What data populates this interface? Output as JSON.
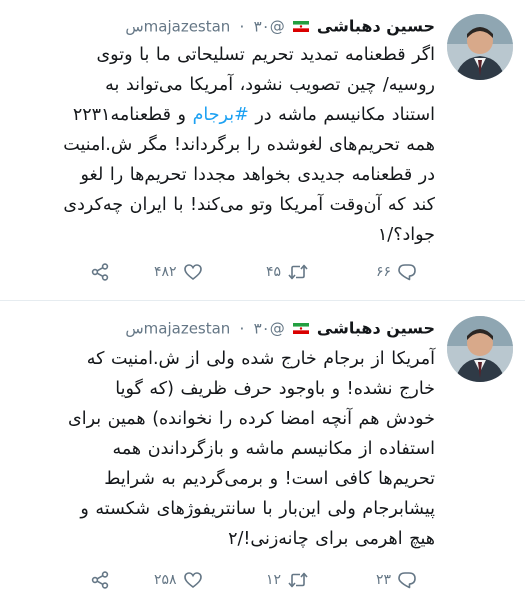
{
  "tweets": [
    {
      "author_name": "حسین دهباشی",
      "handle": "@majazestan",
      "time": "۳۰س",
      "lines": [
        {
          "text": "اگر قطعنامه تمدید تحریم تسلیحاتی ما با وتوی"
        },
        {
          "text": "روسیه/ چین تصویب نشود، آمریکا می‌تواند به"
        },
        {
          "before": "استناد مکانیسم ماشه در ",
          "hashtag": "#برجام",
          "after": " و قطعنامه۲۲۳۱"
        },
        {
          "text": "همه تحریم‌های لغوشده را برگرداند! مگر ش.امنیت"
        },
        {
          "text": "در قطعنامه جدیدی بخواهد مجددا تحریم‌ها را لغو"
        },
        {
          "text": "کند که آن‌وقت آمریکا وتو می‌کند! با ایران چه‌کردی"
        },
        {
          "text": "جواد؟/۱"
        }
      ],
      "replies": "۶۶",
      "retweets": "۴۵",
      "likes": "۴۸۲"
    },
    {
      "author_name": "حسین دهباشی",
      "handle": "@majazestan",
      "time": "۳۰س",
      "lines": [
        {
          "text": "آمریکا از برجام خارج شده ولی از ش.امنیت که"
        },
        {
          "text": "خارج نشده! و باوجود حرف ظریف (که گویا"
        },
        {
          "text": "خودش هم آنچه امضا کرده را نخوانده) همین برای"
        },
        {
          "text": "استفاده از مکانیسم ماشه و بازگرداندن همه"
        },
        {
          "text": "تحریم‌ها کافی است! و برمی‌گردیم به شرایط"
        },
        {
          "text": "پیشابرجام ولی این‌بار با سانتریفوژهای شکسته و"
        },
        {
          "text": "هیچ اهرمی برای چانه‌زنی!/۲"
        }
      ],
      "replies": "۲۳",
      "retweets": "۱۲",
      "likes": "۲۵۸"
    }
  ],
  "icons": {
    "share": "share-icon",
    "like": "heart-icon",
    "retweet": "retweet-icon",
    "reply": "reply-icon",
    "flag": "iran-flag-icon"
  },
  "colors": {
    "text": "#14171a",
    "secondary": "#657786",
    "hashtag": "#1da1f2",
    "divider": "#e6ecf0"
  }
}
